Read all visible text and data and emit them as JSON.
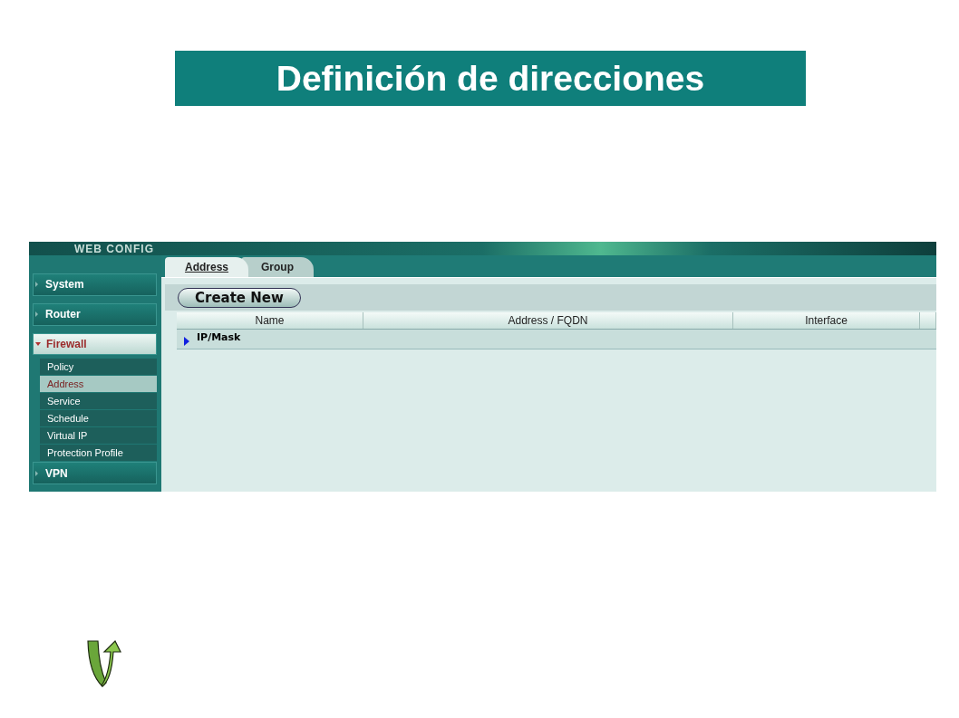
{
  "slide_title": "Definición de direcciones",
  "app": {
    "header_title": "WEB CONFIG",
    "sidebar": {
      "groups": [
        {
          "label": "System",
          "expanded": false
        },
        {
          "label": "Router",
          "expanded": false
        },
        {
          "label": "Firewall",
          "expanded": true,
          "children": [
            {
              "label": "Policy",
              "selected": false
            },
            {
              "label": "Address",
              "selected": true
            },
            {
              "label": "Service",
              "selected": false
            },
            {
              "label": "Schedule",
              "selected": false
            },
            {
              "label": "Virtual IP",
              "selected": false
            },
            {
              "label": "Protection Profile",
              "selected": false
            }
          ]
        },
        {
          "label": "VPN",
          "expanded": false
        }
      ]
    },
    "tabs": [
      {
        "label": "Address",
        "selected": true
      },
      {
        "label": "Group",
        "selected": false
      }
    ],
    "toolbar": {
      "button": "Create New"
    },
    "table": {
      "columns": [
        "Name",
        "Address / FQDN",
        "Interface"
      ],
      "rows": [
        {
          "label": "IP/Mask",
          "expanded": false
        }
      ]
    }
  }
}
